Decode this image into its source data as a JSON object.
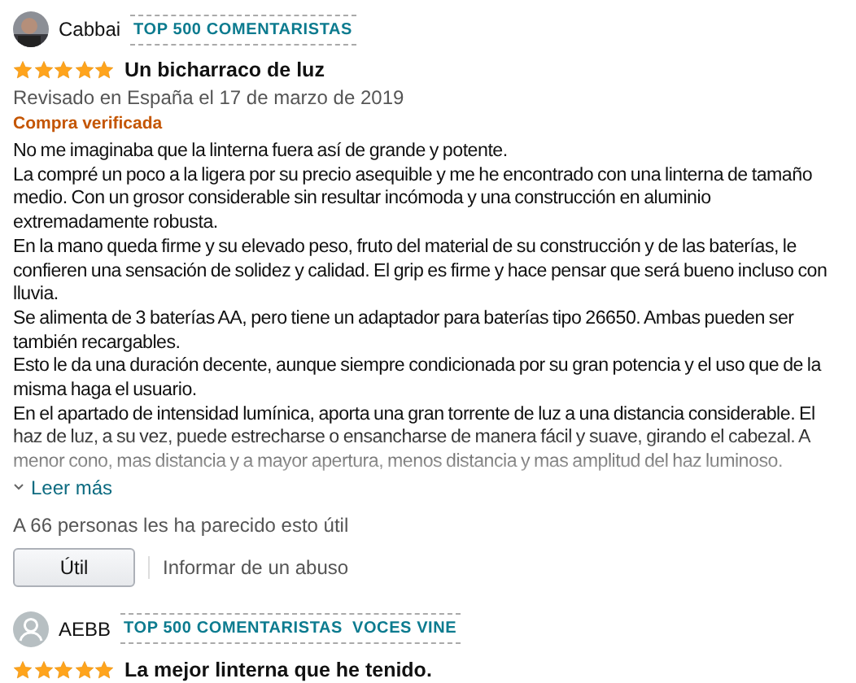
{
  "reviews": [
    {
      "author": "Cabbai",
      "avatar": {
        "kind": "picture"
      },
      "badges": [
        "TOP 500 COMENTARISTAS"
      ],
      "stars": 5,
      "title": "Un bicharraco de luz",
      "date": "Revisado en España el 17 de marzo de 2019",
      "verified": "Compra verificada",
      "truncated": true,
      "body": [
        "No me imaginaba que la linterna fuera así de grande y potente.",
        "La compré un poco a la ligera por su precio asequible y me he encontrado con una linterna de tamaño medio. Con un grosor considerable sin resultar incómoda y una construcción en aluminio extremadamente robusta.",
        "En la mano queda firme y su elevado peso, fruto del material de su construcción y de las baterías, le confieren una sensación de solidez y calidad. El grip es firme y hace pensar que será bueno incluso con lluvia.",
        "Se alimenta de 3 baterías AA, pero tiene un adaptador para baterías tipo 26650. Ambas pueden ser también recargables.",
        "Esto le da una duración decente, aunque siempre condicionada por su gran potencia y el uso que de la misma haga el usuario.",
        "En el apartado de intensidad lumínica, aporta una gran torrente de luz a una distancia considerable. El haz de luz, a su vez, puede estrecharse o ensancharse de manera fácil y suave, girando el cabezal. A menor cono, mas distancia y a mayor apertura, menos distancia y mas amplitud del haz luminoso."
      ],
      "read_more": "Leer más",
      "helpful_count": "A 66 personas les ha parecido esto útil",
      "helpful_button": "Útil",
      "report": "Informar de un abuso"
    },
    {
      "author": "AEBB",
      "avatar": {
        "kind": "silhouette"
      },
      "badges": [
        "TOP 500 COMENTARISTAS",
        "VOCES VINE"
      ],
      "stars": 5,
      "title": "La mejor linterna que he tenido."
    }
  ]
}
